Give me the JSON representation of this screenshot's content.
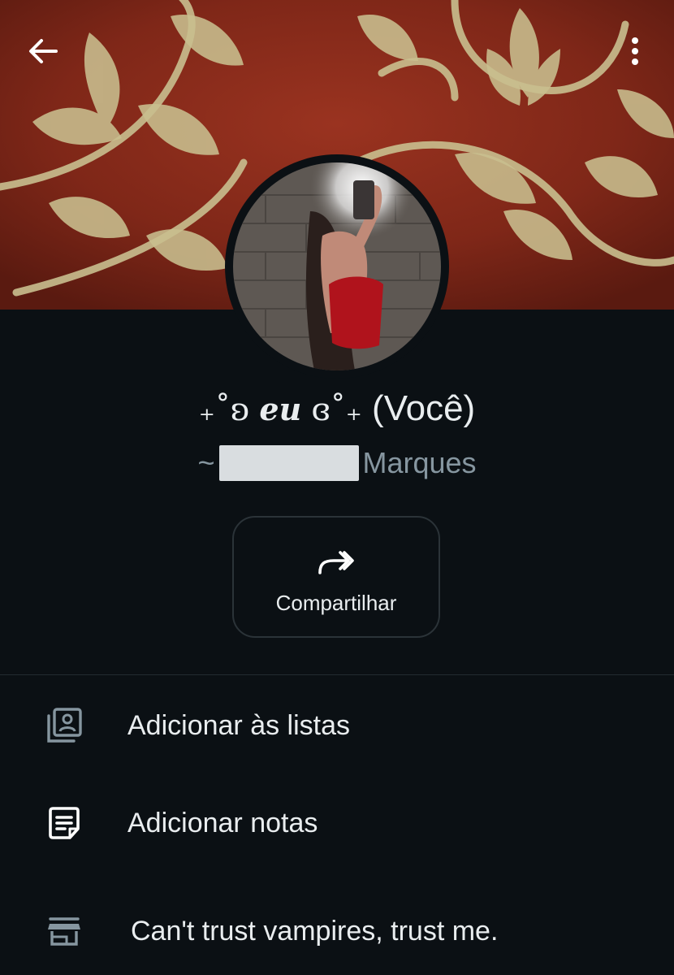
{
  "header": {
    "back_icon": "arrow-left-icon",
    "menu_icon": "more-vertical-icon"
  },
  "profile": {
    "name_prefix": "₊˚ʚ",
    "name_core": "eu",
    "name_suffix": "ɞ˚₊",
    "name_tag": "(Você)",
    "subtitle_tilde": "~",
    "subtitle_surname": "Marques"
  },
  "share": {
    "label": "Compartilhar",
    "icon": "share-forward-icon"
  },
  "options": [
    {
      "icon": "contact-list-icon",
      "label": "Adicionar às listas"
    },
    {
      "icon": "note-icon",
      "label": "Adicionar notas"
    },
    {
      "icon": "storefront-icon",
      "label": "Can't trust vampires, trust me."
    }
  ],
  "colors": {
    "background": "#0b1014",
    "text_primary": "#e9edef",
    "text_secondary": "#8696a0",
    "cover_red": "#8a2a1c",
    "ornament_gold": "#c9bf8f"
  }
}
